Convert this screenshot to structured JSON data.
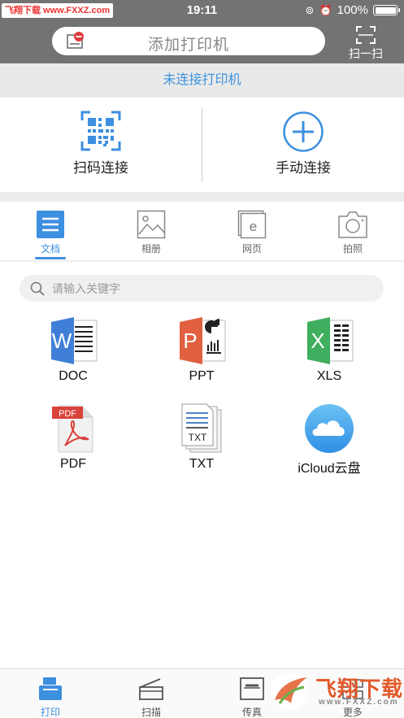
{
  "status_bar": {
    "watermark_badge": "飞翔下载 www.FXXZ.com",
    "time": "19:11",
    "battery_text": "100%",
    "battery_level": 1.0
  },
  "header": {
    "add_printer_label": "添加打印机",
    "scan_label": "扫一扫"
  },
  "banner": {
    "text": "未连接打印机"
  },
  "connect": {
    "scan_connect_label": "扫码连接",
    "manual_connect_label": "手动连接"
  },
  "categories": {
    "items": [
      {
        "label": "文档",
        "active": true
      },
      {
        "label": "相册",
        "active": false
      },
      {
        "label": "网页",
        "active": false
      },
      {
        "label": "拍照",
        "active": false
      }
    ]
  },
  "search": {
    "placeholder": "请输入关键字"
  },
  "files": {
    "items": [
      {
        "label": "DOC",
        "icon": "word-icon",
        "glyph": "W"
      },
      {
        "label": "PPT",
        "icon": "powerpoint-icon",
        "glyph": "P"
      },
      {
        "label": "XLS",
        "icon": "excel-icon",
        "glyph": "X"
      },
      {
        "label": "PDF",
        "icon": "pdf-icon",
        "glyph": "PDF"
      },
      {
        "label": "TXT",
        "icon": "txt-icon",
        "glyph": "TXT"
      },
      {
        "label": "iCloud云盘",
        "icon": "icloud-icon"
      }
    ]
  },
  "bottom_tabs": {
    "items": [
      {
        "label": "打印",
        "active": true
      },
      {
        "label": "扫描",
        "active": false
      },
      {
        "label": "传真",
        "active": false
      },
      {
        "label": "更多",
        "active": false
      }
    ]
  },
  "watermark": {
    "main": "飞翔下载",
    "sub": "www.FXXZ.com"
  },
  "colors": {
    "header_gray": "#737373",
    "accent_blue": "#3d8fe0",
    "word_blue": "#3f7fd8",
    "ppt_red": "#e0603f",
    "excel_green": "#3fae5e",
    "pdf_red": "#d9433b"
  }
}
